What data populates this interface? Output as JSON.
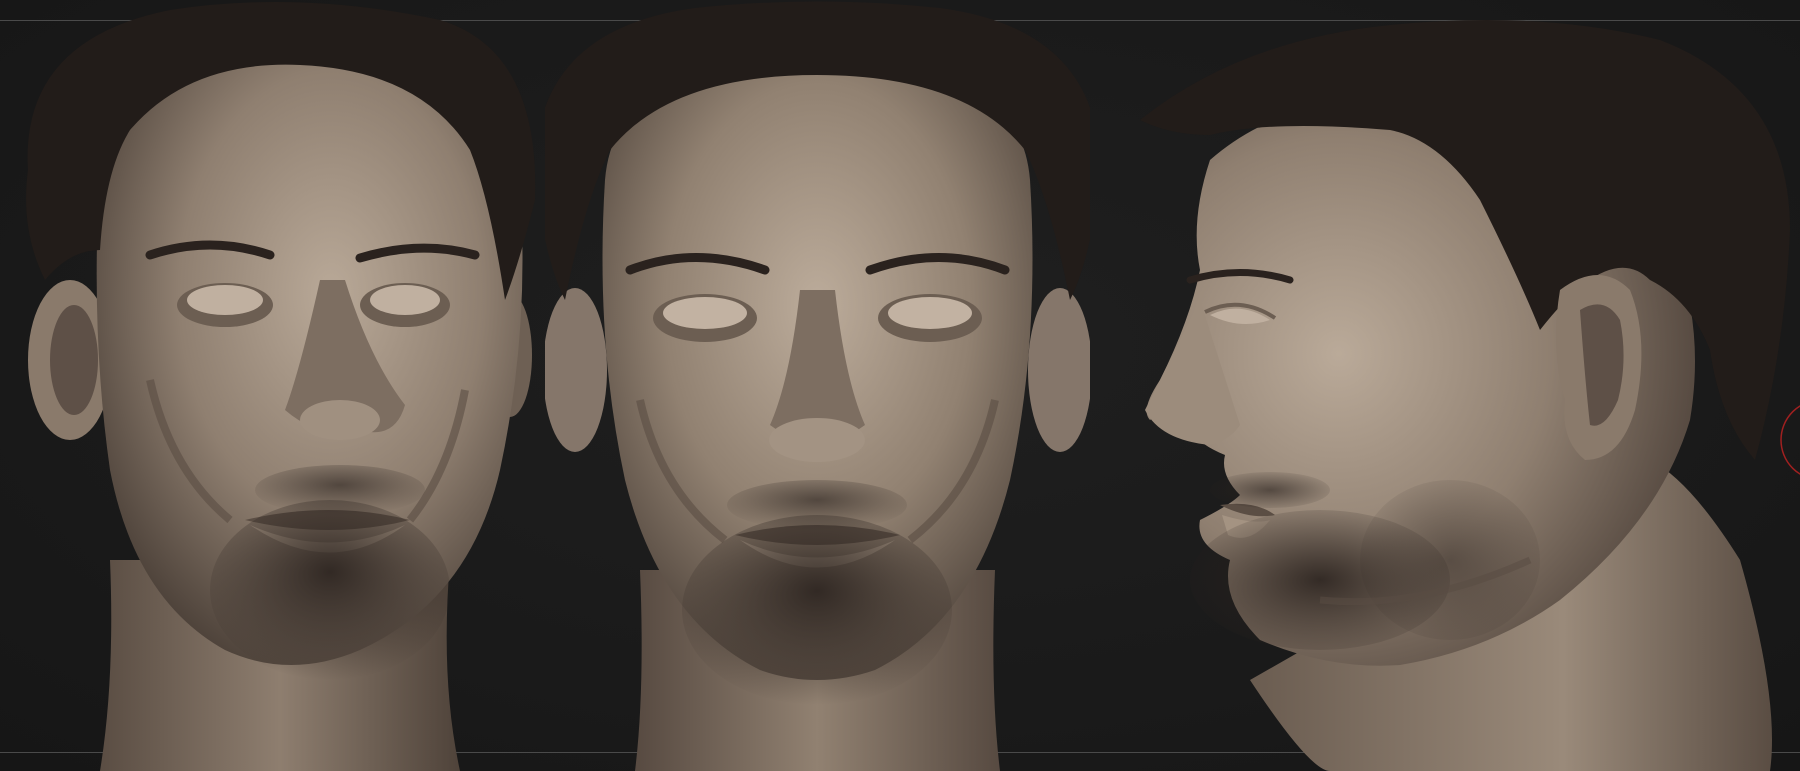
{
  "viewport": {
    "background": "#1a1a1a",
    "views": [
      {
        "name": "front-three-quarter-left",
        "icon": "head-sculpt"
      },
      {
        "name": "front",
        "icon": "head-sculpt"
      },
      {
        "name": "profile-left",
        "icon": "head-sculpt"
      }
    ]
  },
  "colors": {
    "skin": "#8d7d6f",
    "skin_light": "#b7a797",
    "skin_shadow": "#4e4239",
    "hair": "#231d1a",
    "guide": "#4a4a4a",
    "gizmo_ring": "#a02020"
  }
}
